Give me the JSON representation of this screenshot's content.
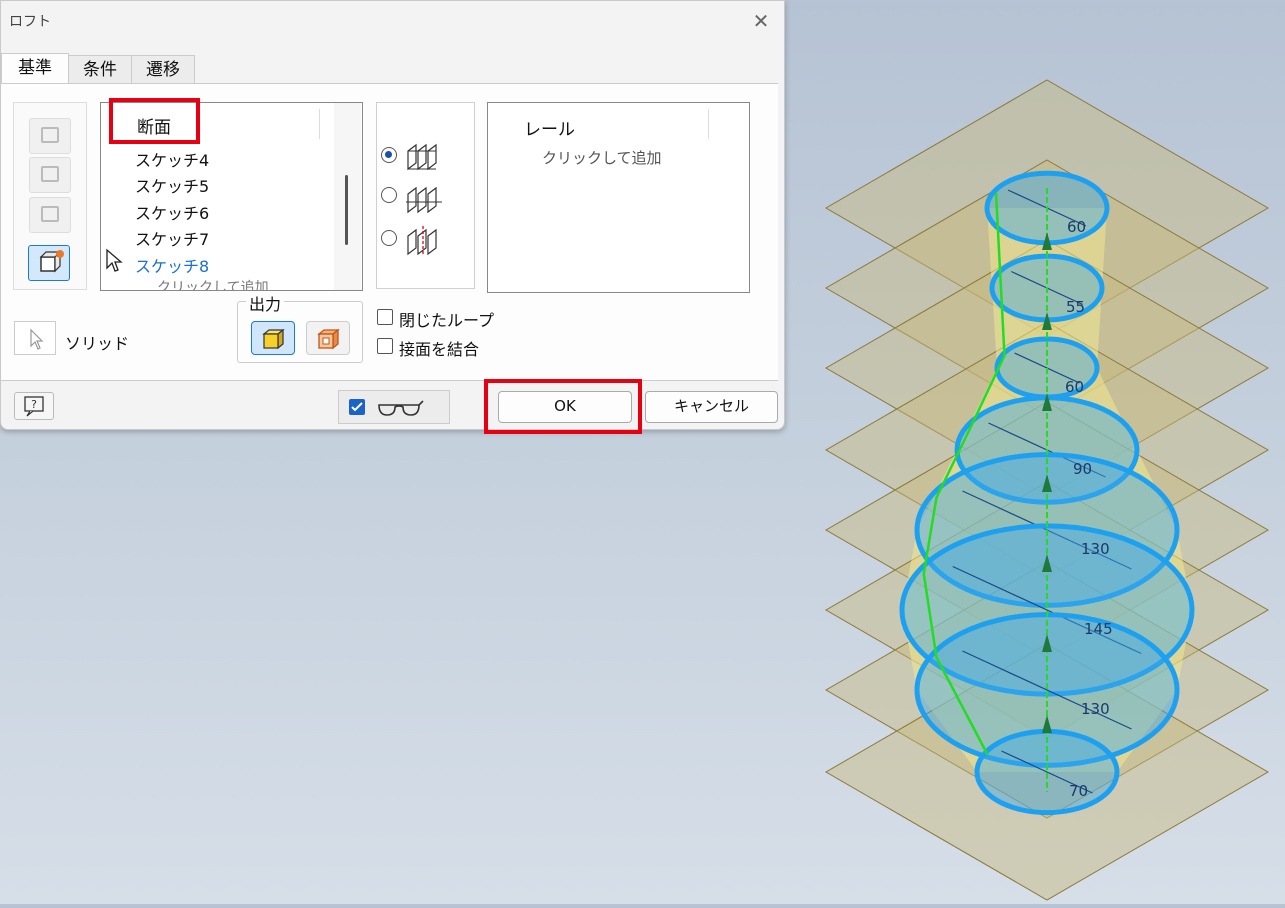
{
  "dialog": {
    "title": "ロフト",
    "close_glyph": "✕",
    "tabs": [
      {
        "label": "基準",
        "active": true
      },
      {
        "label": "条件",
        "active": false
      },
      {
        "label": "遷移",
        "active": false
      }
    ],
    "sections": {
      "header": "断面",
      "items": [
        "スケッチ4",
        "スケッチ5",
        "スケッチ6",
        "スケッチ7",
        "スケッチ8"
      ],
      "selected_index": 4,
      "add_hint": "クリックして追加"
    },
    "rails": {
      "header": "レール",
      "add_hint": "クリックして追加"
    },
    "mode_options": [
      {
        "icon": "sections-icon",
        "selected": true
      },
      {
        "icon": "rails-icon",
        "selected": false
      },
      {
        "icon": "center-line-icon",
        "selected": false
      }
    ],
    "output": {
      "label": "出力",
      "options": [
        {
          "icon": "solid-output-icon",
          "active": true
        },
        {
          "icon": "surface-output-icon",
          "active": false
        }
      ]
    },
    "options": {
      "closed_loop": {
        "label": "閉じたループ",
        "checked": false
      },
      "merge_tangent": {
        "label": "接面を結合",
        "checked": false
      }
    },
    "solid_label": "ソリッド",
    "preview_checked": true,
    "ok_label": "OK",
    "cancel_label": "キャンセル",
    "accent_color": "#1a7ad6",
    "highlight_color": "#e60012"
  },
  "model": {
    "dimensions": [
      "60",
      "55",
      "60",
      "90",
      "130",
      "145",
      "130",
      "70"
    ],
    "section_color": "#1ea0f0",
    "plane_color": "#c8b87a",
    "rail_color": "#22dd22"
  }
}
